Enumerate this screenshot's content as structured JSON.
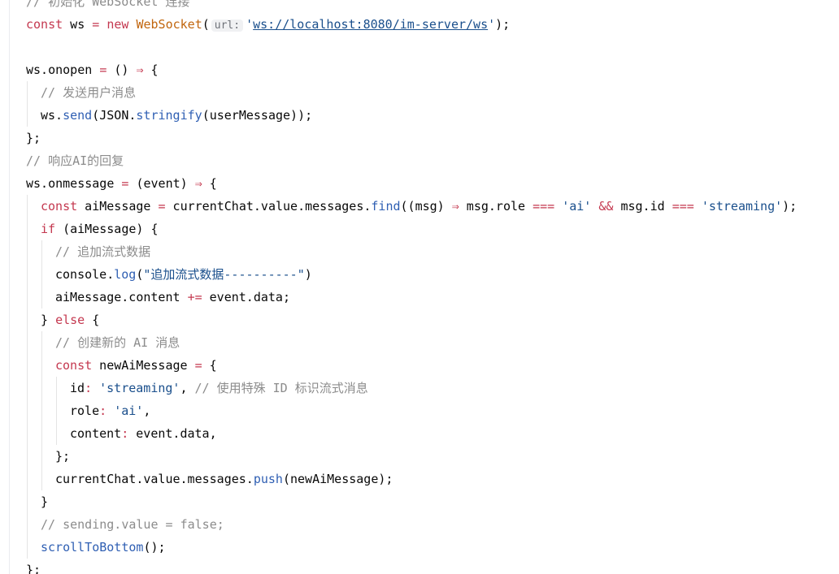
{
  "editor": {
    "lines": [
      {
        "indent": 0,
        "tokens": [
          {
            "t": "cm",
            "v": "// 初始化 WebSocket 连接"
          }
        ]
      },
      {
        "indent": 0,
        "tokens": [
          {
            "t": "kw",
            "v": "const"
          },
          {
            "t": "plain",
            "v": " ws "
          },
          {
            "t": "op",
            "v": "="
          },
          {
            "t": "plain",
            "v": " "
          },
          {
            "t": "kw",
            "v": "new"
          },
          {
            "t": "plain",
            "v": " "
          },
          {
            "t": "cls",
            "v": "WebSocket"
          },
          {
            "t": "plain",
            "v": "("
          },
          {
            "t": "hint",
            "v": "url:"
          },
          {
            "t": "str",
            "v": "'"
          },
          {
            "t": "url",
            "v": "ws://localhost:8080/im-server/ws"
          },
          {
            "t": "str",
            "v": "'"
          },
          {
            "t": "plain",
            "v": ");"
          }
        ]
      },
      {
        "indent": 0,
        "tokens": []
      },
      {
        "indent": 0,
        "tokens": [
          {
            "t": "plain",
            "v": "ws.onopen "
          },
          {
            "t": "op",
            "v": "="
          },
          {
            "t": "plain",
            "v": " () "
          },
          {
            "t": "op",
            "v": "⇒"
          },
          {
            "t": "plain",
            "v": " {"
          }
        ]
      },
      {
        "indent": 1,
        "tokens": [
          {
            "t": "cm",
            "v": "// 发送用户消息"
          }
        ]
      },
      {
        "indent": 1,
        "tokens": [
          {
            "t": "plain",
            "v": "ws."
          },
          {
            "t": "fn",
            "v": "send"
          },
          {
            "t": "plain",
            "v": "(JSON."
          },
          {
            "t": "fn",
            "v": "stringify"
          },
          {
            "t": "plain",
            "v": "(userMessage));"
          }
        ]
      },
      {
        "indent": 0,
        "tokens": [
          {
            "t": "plain",
            "v": "};"
          }
        ]
      },
      {
        "indent": 0,
        "tokens": [
          {
            "t": "cm",
            "v": "// 响应AI的回复"
          }
        ]
      },
      {
        "indent": 0,
        "tokens": [
          {
            "t": "plain",
            "v": "ws.onmessage "
          },
          {
            "t": "op",
            "v": "="
          },
          {
            "t": "plain",
            "v": " (event) "
          },
          {
            "t": "op",
            "v": "⇒"
          },
          {
            "t": "plain",
            "v": " {"
          }
        ]
      },
      {
        "indent": 1,
        "tokens": [
          {
            "t": "kw",
            "v": "const"
          },
          {
            "t": "plain",
            "v": " aiMessage "
          },
          {
            "t": "op",
            "v": "="
          },
          {
            "t": "plain",
            "v": " currentChat.value.messages."
          },
          {
            "t": "fn",
            "v": "find"
          },
          {
            "t": "plain",
            "v": "((msg) "
          },
          {
            "t": "op",
            "v": "⇒"
          },
          {
            "t": "plain",
            "v": " msg.role "
          },
          {
            "t": "op",
            "v": "==="
          },
          {
            "t": "plain",
            "v": " "
          },
          {
            "t": "str",
            "v": "'ai'"
          },
          {
            "t": "plain",
            "v": " "
          },
          {
            "t": "op",
            "v": "&&"
          },
          {
            "t": "plain",
            "v": " msg.id "
          },
          {
            "t": "op",
            "v": "==="
          },
          {
            "t": "plain",
            "v": " "
          },
          {
            "t": "str",
            "v": "'streaming'"
          },
          {
            "t": "plain",
            "v": ");"
          }
        ]
      },
      {
        "indent": 1,
        "tokens": [
          {
            "t": "kw",
            "v": "if"
          },
          {
            "t": "plain",
            "v": " (aiMessage) {"
          }
        ]
      },
      {
        "indent": 2,
        "tokens": [
          {
            "t": "cm",
            "v": "// 追加流式数据"
          }
        ]
      },
      {
        "indent": 2,
        "tokens": [
          {
            "t": "plain",
            "v": "console."
          },
          {
            "t": "fn",
            "v": "log"
          },
          {
            "t": "plain",
            "v": "("
          },
          {
            "t": "str",
            "v": "\"追加流式数据----------\""
          },
          {
            "t": "plain",
            "v": ")"
          }
        ]
      },
      {
        "indent": 2,
        "tokens": [
          {
            "t": "plain",
            "v": "aiMessage.content "
          },
          {
            "t": "op",
            "v": "+="
          },
          {
            "t": "plain",
            "v": " event.data;"
          }
        ]
      },
      {
        "indent": 1,
        "tokens": [
          {
            "t": "plain",
            "v": "} "
          },
          {
            "t": "kw",
            "v": "else"
          },
          {
            "t": "plain",
            "v": " {"
          }
        ]
      },
      {
        "indent": 2,
        "tokens": [
          {
            "t": "cm",
            "v": "// 创建新的 AI 消息"
          }
        ]
      },
      {
        "indent": 2,
        "tokens": [
          {
            "t": "kw",
            "v": "const"
          },
          {
            "t": "plain",
            "v": " newAiMessage "
          },
          {
            "t": "op",
            "v": "="
          },
          {
            "t": "plain",
            "v": " {"
          }
        ]
      },
      {
        "indent": 3,
        "tokens": [
          {
            "t": "plain",
            "v": "id"
          },
          {
            "t": "op",
            "v": ":"
          },
          {
            "t": "plain",
            "v": " "
          },
          {
            "t": "str",
            "v": "'streaming'"
          },
          {
            "t": "plain",
            "v": ", "
          },
          {
            "t": "cm",
            "v": "// 使用特殊 ID 标识流式消息"
          }
        ]
      },
      {
        "indent": 3,
        "tokens": [
          {
            "t": "plain",
            "v": "role"
          },
          {
            "t": "op",
            "v": ":"
          },
          {
            "t": "plain",
            "v": " "
          },
          {
            "t": "str",
            "v": "'ai'"
          },
          {
            "t": "plain",
            "v": ","
          }
        ]
      },
      {
        "indent": 3,
        "tokens": [
          {
            "t": "plain",
            "v": "content"
          },
          {
            "t": "op",
            "v": ":"
          },
          {
            "t": "plain",
            "v": " event.data,"
          }
        ]
      },
      {
        "indent": 2,
        "tokens": [
          {
            "t": "plain",
            "v": "};"
          }
        ]
      },
      {
        "indent": 2,
        "tokens": [
          {
            "t": "plain",
            "v": "currentChat.value.messages."
          },
          {
            "t": "fn",
            "v": "push"
          },
          {
            "t": "plain",
            "v": "(newAiMessage);"
          }
        ]
      },
      {
        "indent": 1,
        "tokens": [
          {
            "t": "plain",
            "v": "}"
          }
        ]
      },
      {
        "indent": 1,
        "tokens": [
          {
            "t": "cm",
            "v": "// sending.value = false;"
          }
        ]
      },
      {
        "indent": 1,
        "tokens": [
          {
            "t": "fn",
            "v": "scrollToBottom"
          },
          {
            "t": "plain",
            "v": "();"
          }
        ]
      },
      {
        "indent": 0,
        "tokens": [
          {
            "t": "plain",
            "v": "};"
          }
        ]
      }
    ]
  },
  "colors": {
    "keyword": "#c4384f",
    "function": "#2f5fb3",
    "class": "#c1650d",
    "string": "#1a4f8c",
    "comment": "#8c8c8c",
    "text": "#080808"
  }
}
